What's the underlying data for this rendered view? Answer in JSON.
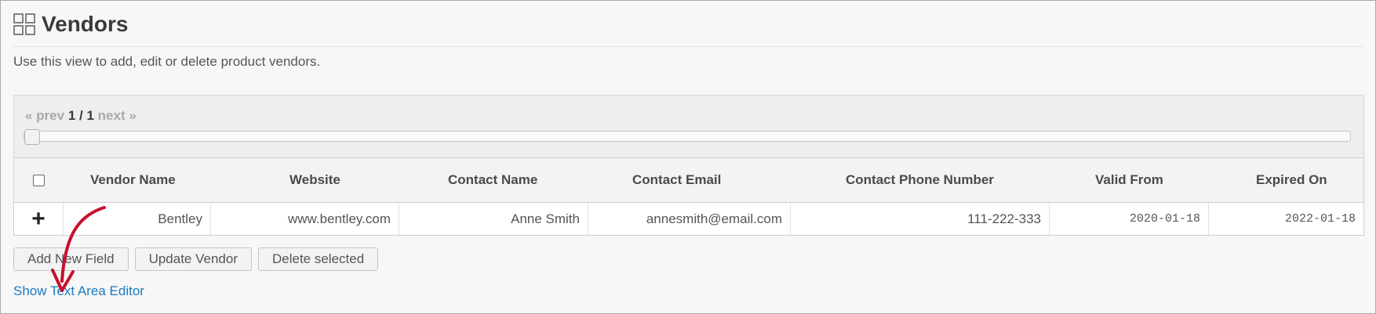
{
  "page": {
    "title": "Vendors",
    "description": "Use this view to add, edit or delete product vendors."
  },
  "pager": {
    "prev": "« prev",
    "current": "1 / 1",
    "next": "next »"
  },
  "table": {
    "columns": [
      "Vendor Name",
      "Website",
      "Contact Name",
      "Contact Email",
      "Contact Phone Number",
      "Valid From",
      "Expired On"
    ],
    "rows": [
      {
        "vendor_name": "Bentley",
        "website": "www.bentley.com",
        "contact_name": "Anne Smith",
        "contact_email": "annesmith@email.com",
        "contact_phone": "111-222-333",
        "valid_from": "2020-01-18",
        "expired_on": "2022-01-18"
      }
    ]
  },
  "buttons": {
    "add_field": "Add New Field",
    "update": "Update Vendor",
    "delete": "Delete selected"
  },
  "link": {
    "text_area_editor": "Show Text Area Editor"
  },
  "colors": {
    "accent_link": "#1a7bbf",
    "annotation_arrow": "#c8102e"
  },
  "icons": {
    "title": "grid-icon",
    "add_row": "plus-icon",
    "annotation": "curved-arrow-annotation"
  }
}
